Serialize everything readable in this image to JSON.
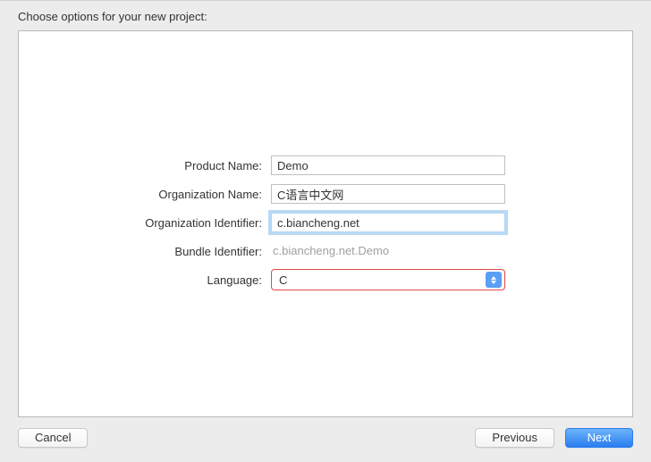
{
  "header": {
    "title": "Choose options for your new project:"
  },
  "form": {
    "productName": {
      "label": "Product Name:",
      "value": "Demo"
    },
    "organizationName": {
      "label": "Organization Name:",
      "value": "C语言中文网"
    },
    "organizationIdentifier": {
      "label": "Organization Identifier:",
      "value": "c.biancheng.net"
    },
    "bundleIdentifier": {
      "label": "Bundle Identifier:",
      "value": "c.biancheng.net.Demo"
    },
    "language": {
      "label": "Language:",
      "value": "C"
    }
  },
  "footer": {
    "cancel": "Cancel",
    "previous": "Previous",
    "next": "Next"
  }
}
